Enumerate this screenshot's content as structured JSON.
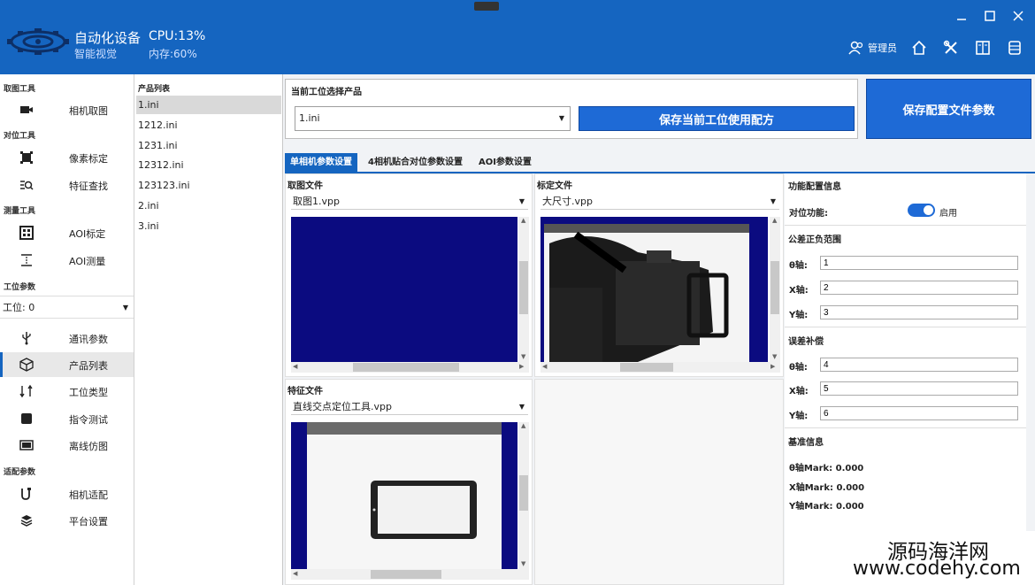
{
  "header": {
    "app_name": "自动化设备",
    "app_sub": "智能视觉",
    "cpu": "CPU:13%",
    "memory": "内存:60%",
    "user_label": "管理员",
    "window_controls": [
      "minimize-icon",
      "maximize-icon",
      "close-icon"
    ],
    "toolbar_icons": [
      "home-icon",
      "tools-icon",
      "book-icon",
      "database-icon"
    ]
  },
  "nav": {
    "sections": {
      "capture": "取图工具",
      "align": "对位工具",
      "measure": "测量工具",
      "station": "工位参数",
      "adapt": "适配参数"
    },
    "items": [
      {
        "label": "相机取图",
        "icon": "camera-icon"
      },
      {
        "label": "像素标定",
        "icon": "frame-icon"
      },
      {
        "label": "特征查找",
        "icon": "search-list-icon"
      },
      {
        "label": "AOI标定",
        "icon": "grid-icon"
      },
      {
        "label": "AOI测量",
        "icon": "measure-icon"
      },
      {
        "label": "通讯参数",
        "icon": "usb-icon"
      },
      {
        "label": "产品列表",
        "icon": "cube-icon"
      },
      {
        "label": "工位类型",
        "icon": "swap-icon"
      },
      {
        "label": "指令测试",
        "icon": "chip-icon"
      },
      {
        "label": "离线仿图",
        "icon": "image-icon"
      },
      {
        "label": "相机适配",
        "icon": "cable-icon"
      },
      {
        "label": "平台设置",
        "icon": "layers-icon"
      }
    ],
    "station_value": "工位: 0"
  },
  "product_list": {
    "title": "产品列表",
    "items": [
      "1.ini",
      "1212.ini",
      "1231.ini",
      "12312.ini",
      "123123.ini",
      "2.ini",
      "3.ini"
    ],
    "selected": "1.ini"
  },
  "product_select": {
    "label": "当前工位选择产品",
    "value": "1.ini",
    "use_button": "保存当前工位使用配方",
    "save_button": "保存配置文件参数"
  },
  "tabs": [
    "单相机参数设置",
    "4相机贴合对位参数设置",
    "AOI参数设置"
  ],
  "files": {
    "capture": {
      "title": "取图文件",
      "value": "取图1.vpp"
    },
    "calib": {
      "title": "标定文件",
      "value": "大尺寸.vpp"
    },
    "feature": {
      "title": "特征文件",
      "value": "直线交点定位工具.vpp"
    }
  },
  "config": {
    "func_title": "功能配置信息",
    "align_label": "对位功能:",
    "align_state": "启用",
    "align_enabled": true,
    "tol_title": "公差正负范围",
    "tol": [
      {
        "label": "θ轴:",
        "value": "1"
      },
      {
        "label": "X轴:",
        "value": "2"
      },
      {
        "label": "Y轴:",
        "value": "3"
      }
    ],
    "comp_title": "误差补偿",
    "comp": [
      {
        "label": "θ轴:",
        "value": "4"
      },
      {
        "label": "X轴:",
        "value": "5"
      },
      {
        "label": "Y轴:",
        "value": "6"
      }
    ],
    "ref_title": "基准信息",
    "marks": [
      "θ轴Mark: 0.000",
      "X轴Mark: 0.000",
      "Y轴Mark: 0.000"
    ]
  },
  "watermark": {
    "line1": "源码海洋网",
    "line2": "www.codehy.com"
  },
  "colors": {
    "primary": "#1565c0",
    "button": "#1e6ad6",
    "viewer_bg": "#0b0b80"
  }
}
